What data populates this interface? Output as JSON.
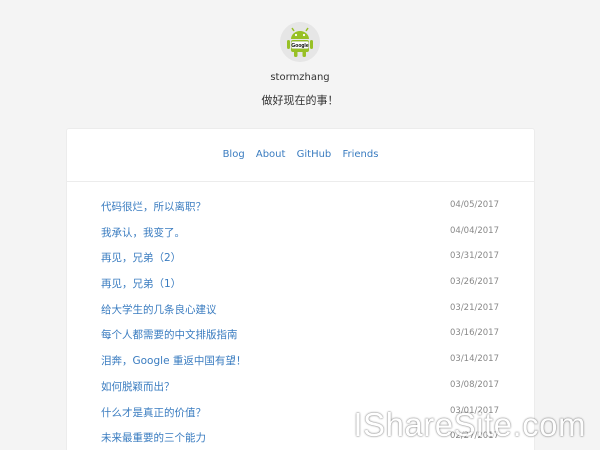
{
  "profile": {
    "avatar_icon": "android-google-avatar",
    "avatar_text": "Google",
    "username": "stormzhang",
    "tagline": "做好现在的事！"
  },
  "nav": {
    "items": [
      {
        "label": "Blog"
      },
      {
        "label": "About"
      },
      {
        "label": "GitHub"
      },
      {
        "label": "Friends"
      }
    ]
  },
  "posts": [
    {
      "title": "代码很烂，所以离职？",
      "date": "04/05/2017"
    },
    {
      "title": "我承认，我变了。",
      "date": "04/04/2017"
    },
    {
      "title": "再见，兄弟（2）",
      "date": "03/31/2017"
    },
    {
      "title": "再见，兄弟（1）",
      "date": "03/26/2017"
    },
    {
      "title": "给大学生的几条良心建议",
      "date": "03/21/2017"
    },
    {
      "title": "每个人都需要的中文排版指南",
      "date": "03/16/2017"
    },
    {
      "title": "泪奔，Google 重返中国有望！",
      "date": "03/14/2017"
    },
    {
      "title": "如何脱颖而出？",
      "date": "03/08/2017"
    },
    {
      "title": "什么才是真正的价值？",
      "date": "03/01/2017"
    },
    {
      "title": "未来最重要的三个能力",
      "date": "02/27/2017"
    }
  ],
  "watermark": "IShareSite.com",
  "colors": {
    "link": "#3a7cc0",
    "page_background": "#f4f4f4",
    "card_background": "#ffffff",
    "date_text": "#888888",
    "android_green": "#97c024"
  }
}
